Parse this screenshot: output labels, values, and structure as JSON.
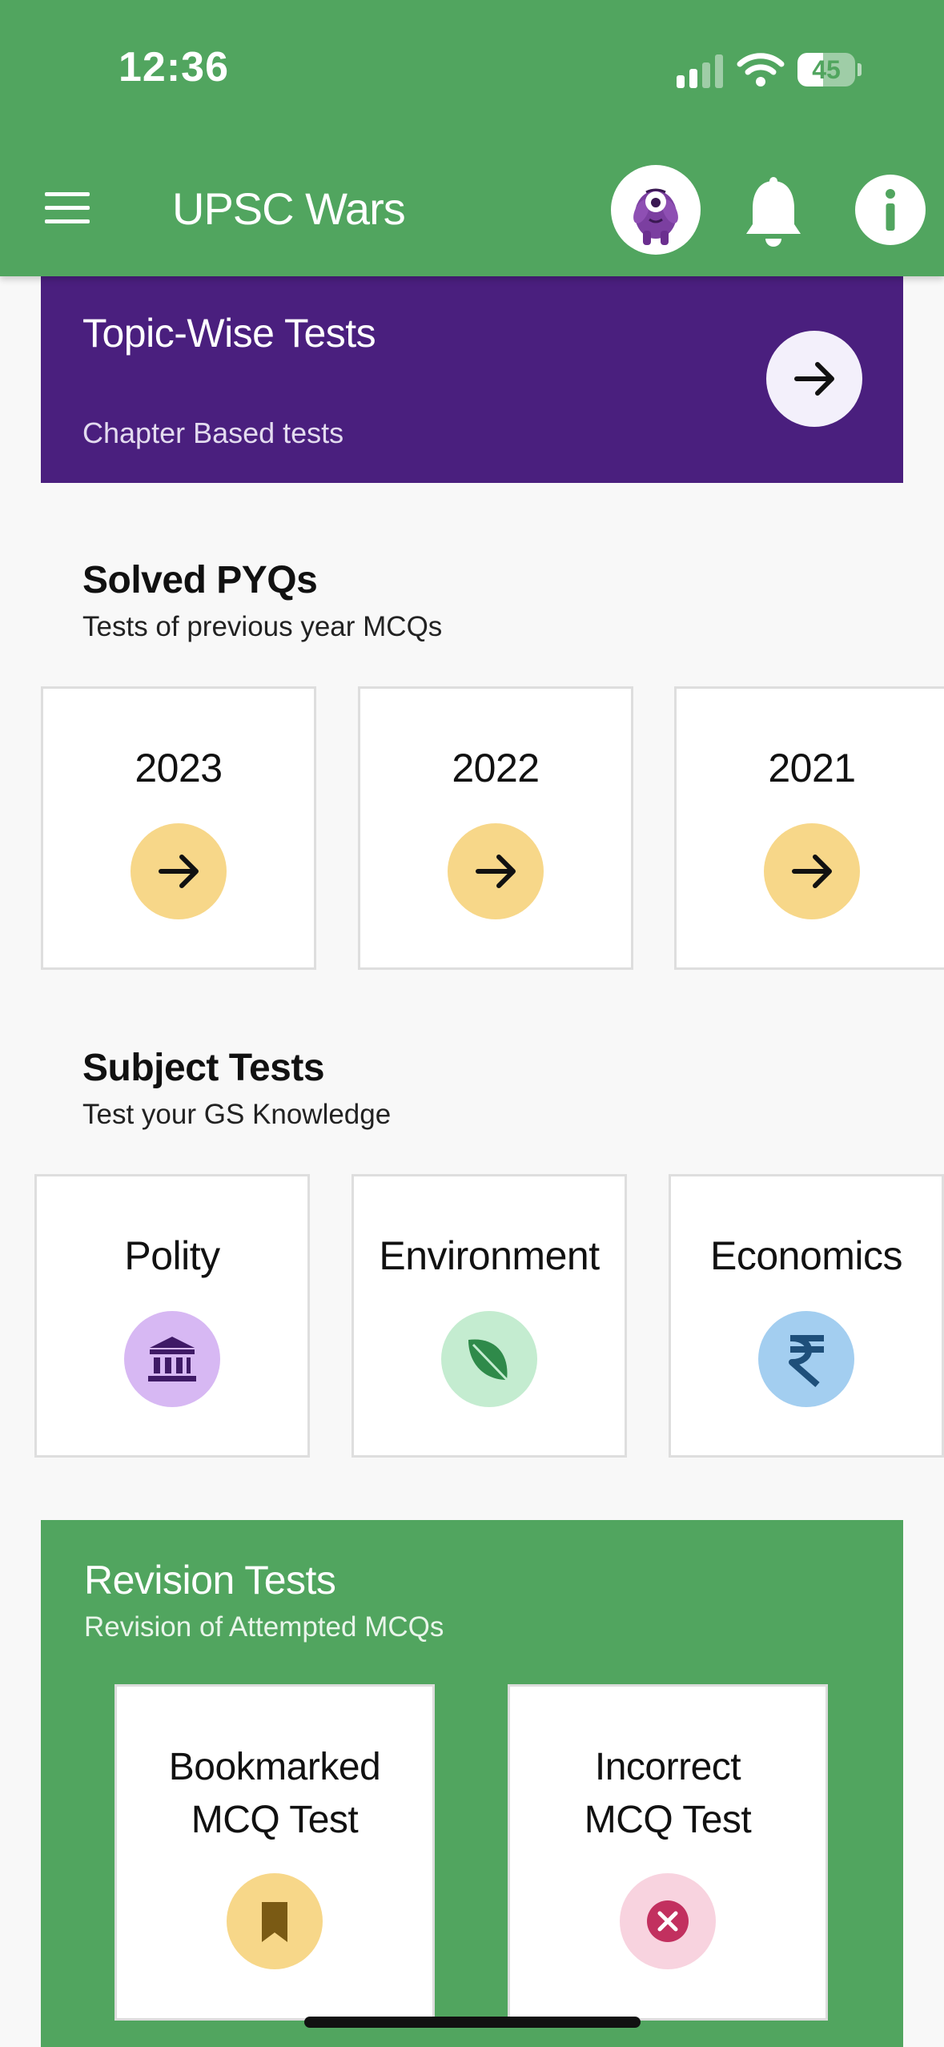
{
  "status_bar": {
    "time": "12:36",
    "battery": "45",
    "battery_level": 0.45
  },
  "app_bar": {
    "title": "UPSC Wars"
  },
  "topic_banner": {
    "title": "Topic-Wise Tests",
    "subtitle": "Chapter Based tests"
  },
  "pyq_section": {
    "title": "Solved PYQs",
    "subtitle": "Tests of previous year MCQs",
    "cards": [
      {
        "year": "2023"
      },
      {
        "year": "2022"
      },
      {
        "year": "2021"
      }
    ]
  },
  "subject_section": {
    "title": "Subject Tests",
    "subtitle": "Test your GS Knowledge",
    "cards": [
      {
        "label": "Polity",
        "icon": "bank-icon",
        "color": "#d7b8f3"
      },
      {
        "label": "Environment",
        "icon": "leaf-icon",
        "color": "#c4ecd0"
      },
      {
        "label": "Economics",
        "icon": "rupee-icon",
        "color": "#a3cef0"
      }
    ]
  },
  "revision_section": {
    "title": "Revision Tests",
    "subtitle": "Revision of Attempted MCQs",
    "cards": [
      {
        "line1": "Bookmarked",
        "line2": "MCQ Test",
        "icon": "bookmark-icon",
        "color": "#f7d789"
      },
      {
        "line1": "Incorrect",
        "line2": "MCQ Test",
        "icon": "close-circle-icon",
        "color": "#f8d3df"
      }
    ]
  },
  "colors": {
    "primary_green": "#51a55f",
    "topic_purple": "#4a1f7e",
    "pyq_circle": "#f7d789",
    "background": "#f8f8f8"
  }
}
